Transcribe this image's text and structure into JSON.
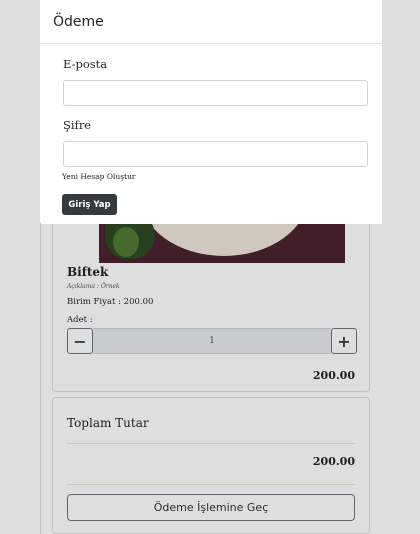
{
  "modal": {
    "title": "Ödeme",
    "email_label": "E-posta",
    "email_value": "",
    "password_label": "Şifre",
    "password_value": "",
    "create_account_link": "Yeni Hesap Oluştur",
    "login_button": "Giriş Yap"
  },
  "product": {
    "name": "Biftek",
    "description": "Açıklama : Örnek",
    "unit_price": "Birim Fiyat : 200.00",
    "quantity_label": "Adet :",
    "quantity": "1",
    "minus_symbol": "−",
    "plus_symbol": "+",
    "line_total": "200.00"
  },
  "summary": {
    "title": "Toplam Tutar",
    "amount": "200.00",
    "checkout_button": "Ödeme İşlemine Geç"
  },
  "colors": {
    "dark_button": "#343a40",
    "border": "#ced4da"
  }
}
